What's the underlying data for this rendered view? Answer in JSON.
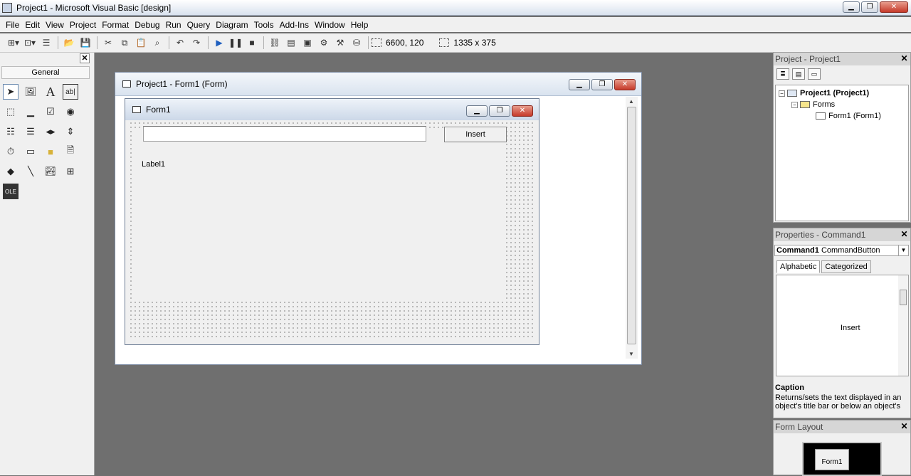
{
  "window": {
    "title": "Project1 - Microsoft Visual Basic [design]"
  },
  "menu": [
    "File",
    "Edit",
    "View",
    "Project",
    "Format",
    "Debug",
    "Run",
    "Query",
    "Diagram",
    "Tools",
    "Add-Ins",
    "Window",
    "Help"
  ],
  "toolbar": {
    "position": "6600, 120",
    "size": "1335 x 375"
  },
  "toolbox": {
    "tab_label": "General"
  },
  "designer": {
    "title": "Project1 - Form1 (Form)"
  },
  "form1": {
    "title": "Form1",
    "textbox_value": "",
    "command_caption": "Insert",
    "label_caption": "Label1"
  },
  "project_panel": {
    "title": "Project - Project1",
    "root": "Project1 (Project1)",
    "folder": "Forms",
    "form_item": "Form1 (Form1)"
  },
  "properties_panel": {
    "title": "Properties - Command1",
    "object_name": "Command1",
    "object_type": "CommandButton",
    "tabs": [
      "Alphabetic",
      "Categorized"
    ],
    "caption_value": "Insert",
    "desc_title": "Caption",
    "desc_text": "Returns/sets the text displayed in an object's title bar or below an object's"
  },
  "layout_panel": {
    "title": "Form Layout",
    "form_label": "Form1"
  }
}
